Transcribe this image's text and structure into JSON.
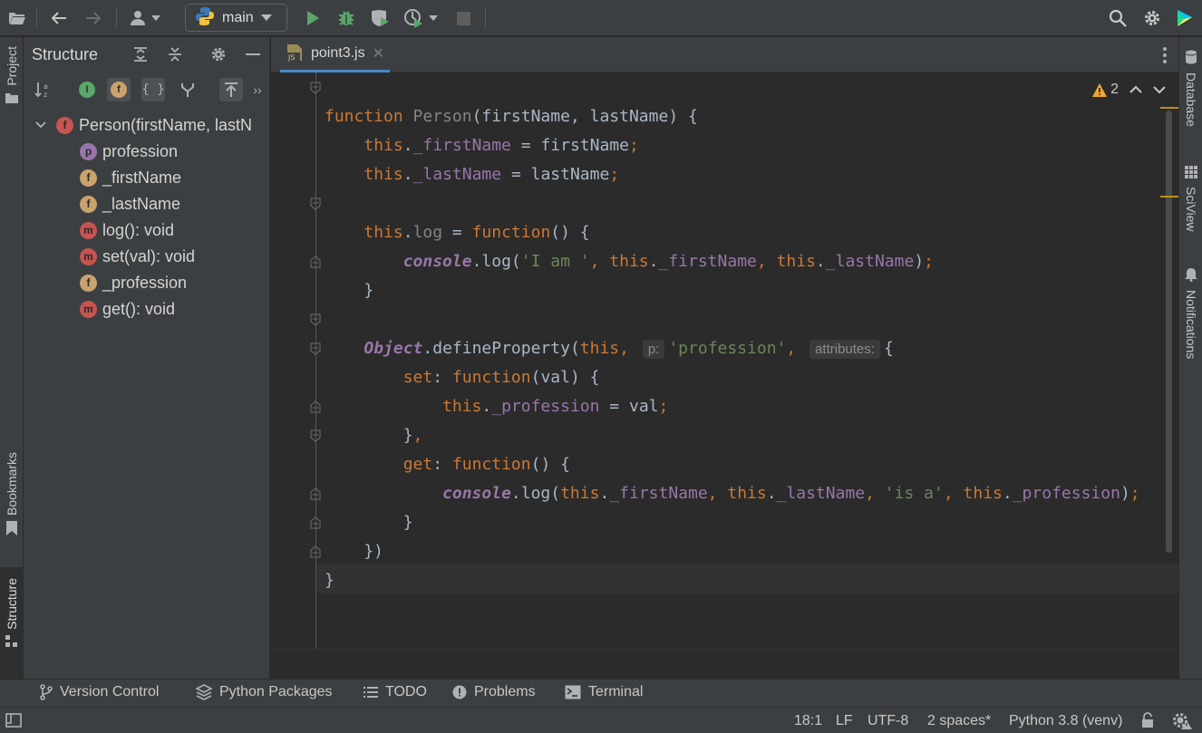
{
  "toolbar": {
    "branch": "main",
    "icons": [
      "open-folder-icon",
      "back-arrow-icon",
      "forward-arrow-icon",
      "user-icon",
      "python-icon",
      "run-icon",
      "debug-icon",
      "coverage-icon",
      "profile-icon",
      "stop-icon",
      "search-icon",
      "gear-icon",
      "toolbox-icon"
    ]
  },
  "left_stripe": {
    "project": "Project",
    "bookmarks": "Bookmarks",
    "structure": "Structure"
  },
  "right_stripe": {
    "database": "Database",
    "sciview": "SciView",
    "notifications": "Notifications"
  },
  "structure": {
    "title": "Structure",
    "tree": [
      {
        "icon": "f",
        "color": "#c75450",
        "label": "Person(firstName, lastN",
        "level": 0
      },
      {
        "icon": "p",
        "color": "#9876aa",
        "label": "profession",
        "level": 1
      },
      {
        "icon": "f",
        "color": "#c9a26d",
        "label": "_firstName",
        "level": 1
      },
      {
        "icon": "f",
        "color": "#c9a26d",
        "label": "_lastName",
        "level": 1
      },
      {
        "icon": "m",
        "color": "#c75450",
        "label": "log(): void",
        "level": 1
      },
      {
        "icon": "m",
        "color": "#c75450",
        "label": "set(val): void",
        "level": 1
      },
      {
        "icon": "f",
        "color": "#c9a26d",
        "label": "_profession",
        "level": 1
      },
      {
        "icon": "m",
        "color": "#c75450",
        "label": "get(): void",
        "level": 1
      }
    ]
  },
  "editor": {
    "tab_label": "point3.js",
    "tab_badge": "JS",
    "warning_count": "2",
    "hints": {
      "p": "p:",
      "attributes": "attributes:"
    }
  },
  "bottom_tools": {
    "version_control": "Version Control",
    "python_packages": "Python Packages",
    "todo": "TODO",
    "problems": "Problems",
    "terminal": "Terminal"
  },
  "status": {
    "position": "18:1",
    "line_sep": "LF",
    "encoding": "UTF-8",
    "indent": "2 spaces*",
    "interpreter": "Python 3.8 (venv)"
  }
}
